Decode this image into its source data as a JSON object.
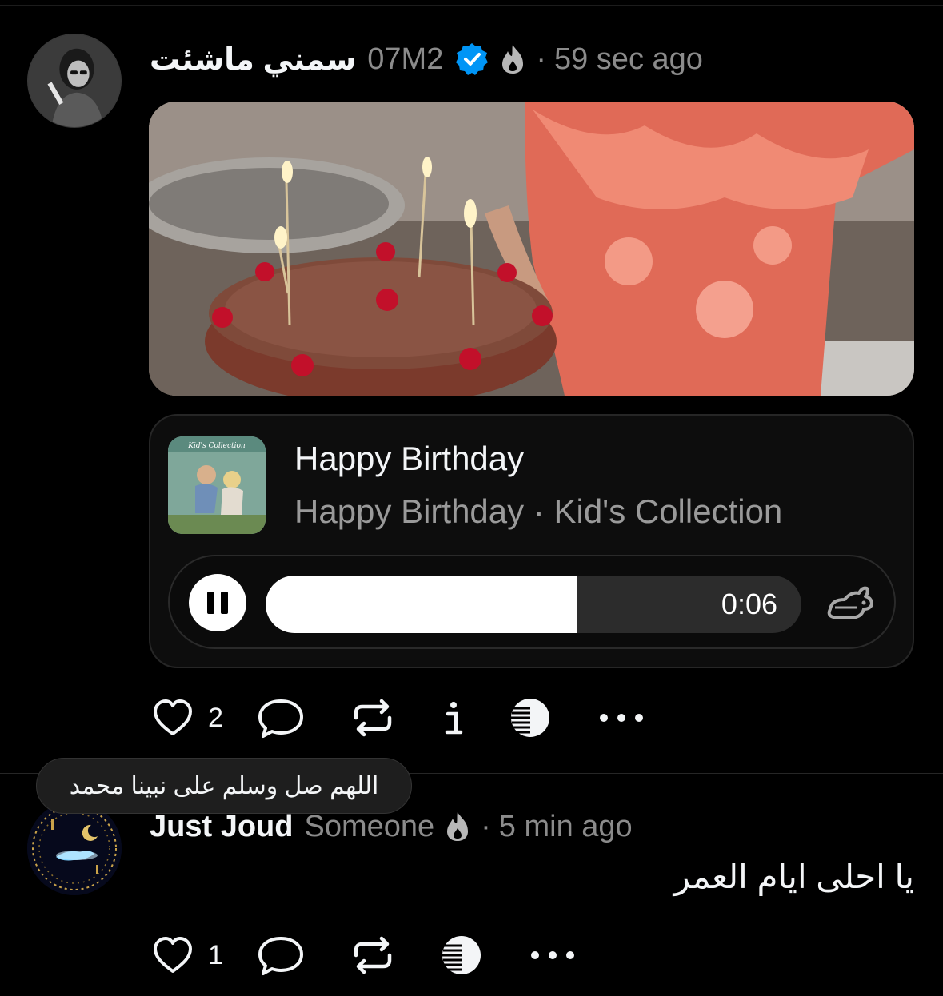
{
  "post": {
    "username": "سمني ماشئت",
    "handle": "07M2",
    "verified_icon": "verified-badge-icon",
    "flame_icon": "flame-icon",
    "separator": "·",
    "time": "59 sec ago",
    "media_icon": "video-thumbnail",
    "music": {
      "title": "Happy Birthday",
      "subtitle": "Happy Birthday · Kid's Collection",
      "album_art_text": "Kid's Collection",
      "playback_time": "0:06",
      "progress_fraction": 0.58,
      "pause_icon": "pause-icon",
      "speed_icon": "rabbit-speed-icon"
    },
    "actions": {
      "like_count": "2",
      "like_icon": "heart-icon",
      "reply_icon": "comment-icon",
      "repost_icon": "repost-icon",
      "info_icon": "info-icon",
      "edit_icon": "striped-circle-icon",
      "more_icon": "more-icon"
    }
  },
  "tooltip": "اللهم صل وسلم على نبينا محمد",
  "reply": {
    "username": "Just Joud",
    "handle": "Someone",
    "separator": "·",
    "time": "5 min ago",
    "text": "يا احلى ايام العمر",
    "actions": {
      "like_count": "1"
    }
  },
  "colors": {
    "background": "#000000",
    "verified": "#0095f6",
    "secondary_text": "#8b8b8b"
  }
}
